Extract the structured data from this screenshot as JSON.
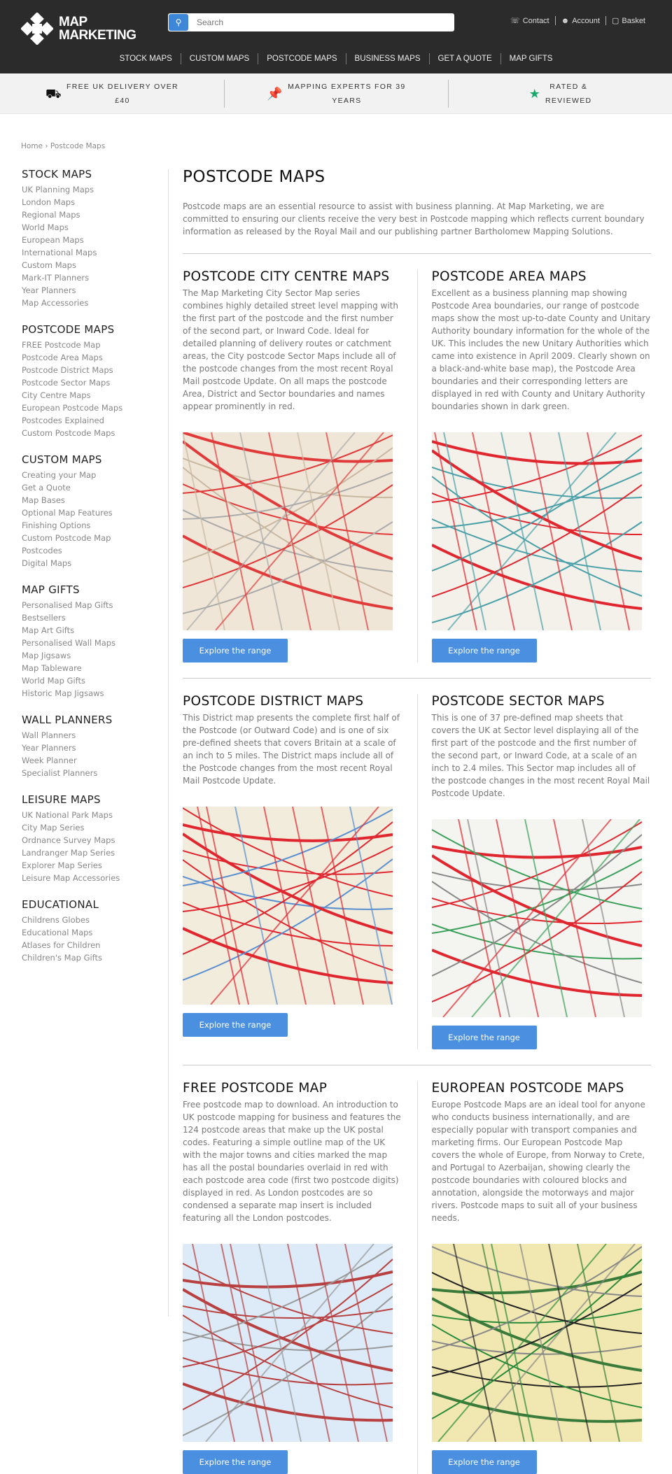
{
  "header": {
    "logo": "MAP MARKETING",
    "logo_line1": "MAP",
    "logo_line2": "MARKETING",
    "search_placeholder": "Search",
    "links": [
      {
        "label": "Contact",
        "icon": "phone-icon"
      },
      {
        "label": "Account",
        "icon": "user-icon"
      },
      {
        "label": "Basket",
        "icon": "basket-icon"
      }
    ],
    "nav": [
      "STOCK MAPS",
      "CUSTOM MAPS",
      "POSTCODE MAPS",
      "BUSINESS MAPS",
      "GET A QUOTE",
      "MAP GIFTS"
    ]
  },
  "usp": [
    {
      "line1": "FREE UK DELIVERY OVER",
      "line2": "£40",
      "icon": "truck-icon"
    },
    {
      "line1": "MAPPING EXPERTS FOR 39",
      "line2": "YEARS",
      "icon": "map-pin-icon"
    },
    {
      "line1": "RATED &",
      "line2": "REVIEWED",
      "icon": "star-icon"
    }
  ],
  "breadcrumb": {
    "home": "Home",
    "sep": "›",
    "current": "Postcode Maps"
  },
  "sidebar": [
    {
      "title": "STOCK MAPS",
      "items": [
        "UK Planning Maps",
        "London Maps",
        "Regional Maps",
        "World Maps",
        "European Maps",
        "International Maps",
        "Custom Maps",
        "Mark-IT Planners",
        "Year Planners",
        "Map Accessories"
      ]
    },
    {
      "title": "POSTCODE MAPS",
      "items": [
        "FREE Postcode Map",
        "Postcode Area Maps",
        "Postcode District Maps",
        "Postcode Sector Maps",
        "City Centre Maps",
        "European Postcode Maps",
        "Postcodes Explained",
        "Custom Postcode Maps"
      ]
    },
    {
      "title": "CUSTOM MAPS",
      "items": [
        "Creating your Map",
        "Get a Quote",
        "Map Bases",
        "Optional Map Features",
        "Finishing Options",
        "Custom Postcode Map",
        "Postcodes",
        "Digital Maps"
      ]
    },
    {
      "title": "MAP GIFTS",
      "items": [
        "Personalised Map Gifts",
        "Bestsellers",
        "Map Art Gifts",
        "Personalised Wall Maps",
        "Map Jigsaws",
        "Map Tableware",
        "World Map Gifts",
        "Historic Map Jigsaws"
      ]
    },
    {
      "title": "WALL PLANNERS",
      "items": [
        "Wall Planners",
        "Year Planners",
        "Week Planner",
        "Specialist Planners"
      ]
    },
    {
      "title": "LEISURE MAPS",
      "items": [
        "UK National Park Maps",
        "City Map Series",
        "Ordnance Survey Maps",
        "Landranger Map Series",
        "Explorer Map Series",
        "Leisure Map Accessories"
      ]
    },
    {
      "title": "EDUCATIONAL",
      "items": [
        "Childrens Globes",
        "Educational Maps",
        "Atlases for Children",
        "Children's Map Gifts"
      ]
    }
  ],
  "main": {
    "title": "POSTCODE MAPS",
    "intro": "Postcode maps are an essential resource to assist with business planning. At Map Marketing, we are committed to ensuring our clients receive the very best in Postcode mapping which reflects current boundary information as released by the Royal Mail and our publishing partner Bartholomew Mapping Solutions.",
    "button_label": "Explore the range",
    "cards": [
      {
        "title": "POSTCODE CITY CENTRE MAPS",
        "text": "The Map Marketing City Sector Map series combines highly detailed street level mapping with the first part of the postcode and the first number of the second part, or Inward Code. Ideal for detailed planning of delivery routes or catchment areas, the City postcode Sector Maps include all of the postcode changes from the most recent Royal Mail postcode Update. On all maps the postcode Area, District and Sector boundaries and names appear prominently in red."
      },
      {
        "title": "POSTCODE AREA MAPS",
        "text": "Excellent as a business planning map showing Postcode Area boundaries, our range of postcode maps show the most up-to-date County and Unitary Authority boundary information for the whole of the UK. This includes the new Unitary Authorities which came into existence in April 2009. Clearly shown on a black-and-white base map), the Postcode Area boundaries and their corresponding letters are displayed in red with County and Unitary Authority boundaries shown in dark green."
      },
      {
        "title": "POSTCODE DISTRICT MAPS",
        "text": "This District map presents the complete first half of the Postcode (or Outward Code) and is one of six pre-defined sheets that covers Britain at a scale of an inch to 5 miles. The District maps include all of the Postcode changes from the most recent Royal Mail Postcode Update."
      },
      {
        "title": "POSTCODE SECTOR MAPS",
        "text": "This is one of 37 pre-defined map sheets that covers the UK at Sector level displaying all of the first part of the postcode and the first number of the second part, or Inward Code, at a scale of an inch to 2.4 miles. This Sector map includes all of the postcode changes in the most recent Royal Mail Postcode Update."
      },
      {
        "title": "FREE POSTCODE MAP",
        "text": "Free postcode map to download. An introduction to UK postcode mapping for business and features the 124 postcode areas that make up the UK postal codes. Featuring a simple outline map of the UK with the major towns and cities marked the map has all the postal boundaries overlaid in red with each postcode area code (first two postcode digits) displayed in red. As London postcodes are so condensed a separate map insert is included featuring all the London postcodes."
      },
      {
        "title": "EUROPEAN POSTCODE MAPS",
        "text": "Europe Postcode Maps are an ideal tool for anyone who conducts business internationally, and are especially popular with transport companies and marketing firms. Our European Postcode Map covers the whole of Europe, from Norway to Crete, and Portugal to Azerbaijan, showing clearly the postcode boundaries with coloured blocks and annotation, alongside the motorways and major rivers. Postcode maps to suit all of your business needs."
      }
    ]
  },
  "colors": {
    "header_bg": "#2b2b2b",
    "accent": "#4a8fe0",
    "usp_bg": "#f2f2f2",
    "map_red": "#e0262f"
  }
}
